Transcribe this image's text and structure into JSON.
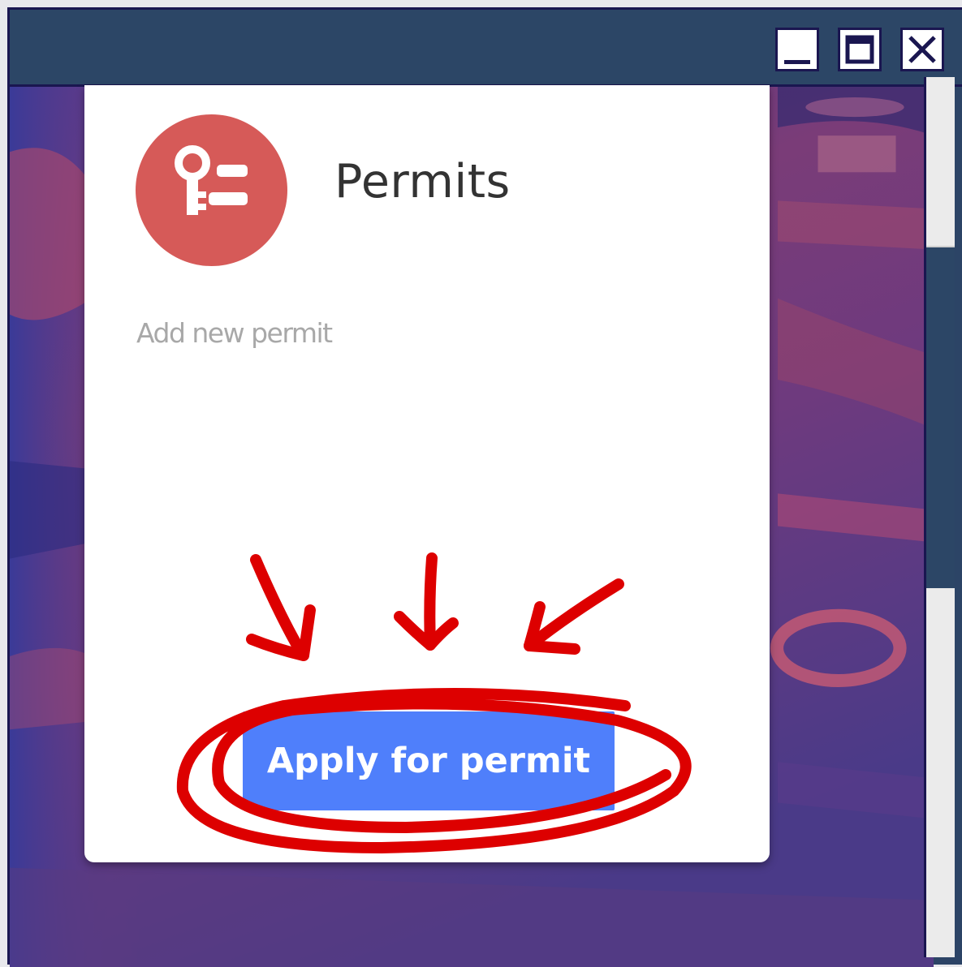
{
  "window": {
    "controls": {
      "minimize_icon": "minimize-icon",
      "maximize_icon": "maximize-icon",
      "close_icon": "close-icon"
    }
  },
  "card": {
    "icon": "key-list-icon",
    "title": "Permits",
    "subtitle": "Add new permit",
    "action_label": "Apply for permit"
  },
  "colors": {
    "titlebar": "#2c4666",
    "icon_circle": "#d65a58",
    "button": "#4f7ffb",
    "annotation": "#dd0000"
  }
}
